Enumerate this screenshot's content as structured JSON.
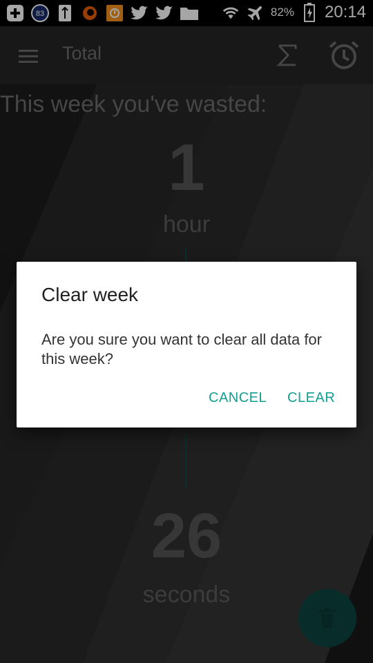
{
  "status_bar": {
    "notification_badge": "83",
    "battery_percent": "82%",
    "time": "20:14",
    "left_icons": [
      "plus-icon",
      "badge-83-icon",
      "usb-icon",
      "firefox-icon",
      "orange-app-icon",
      "twitter-icon",
      "twitter-icon-2",
      "folder-icon"
    ],
    "right_icons": [
      "wifi-icon",
      "airplane-icon",
      "battery-charging-icon"
    ]
  },
  "appbar": {
    "title": "Total",
    "icons": [
      "menu-icon",
      "sigma-icon",
      "alarm-clock-icon"
    ]
  },
  "summary": {
    "heading": "This week you've wasted:",
    "hours_value": "1",
    "hours_unit": "hour",
    "seconds_value": "26",
    "seconds_unit": "seconds"
  },
  "dialog": {
    "title": "Clear week",
    "message": "Are you sure you want to clear all data for this week?",
    "cancel_label": "CANCEL",
    "confirm_label": "CLEAR"
  },
  "fab": {
    "icon": "trash-icon"
  },
  "colors": {
    "accent": "#139e92",
    "fab": "#0b4440",
    "background": "#2f2f2f"
  }
}
